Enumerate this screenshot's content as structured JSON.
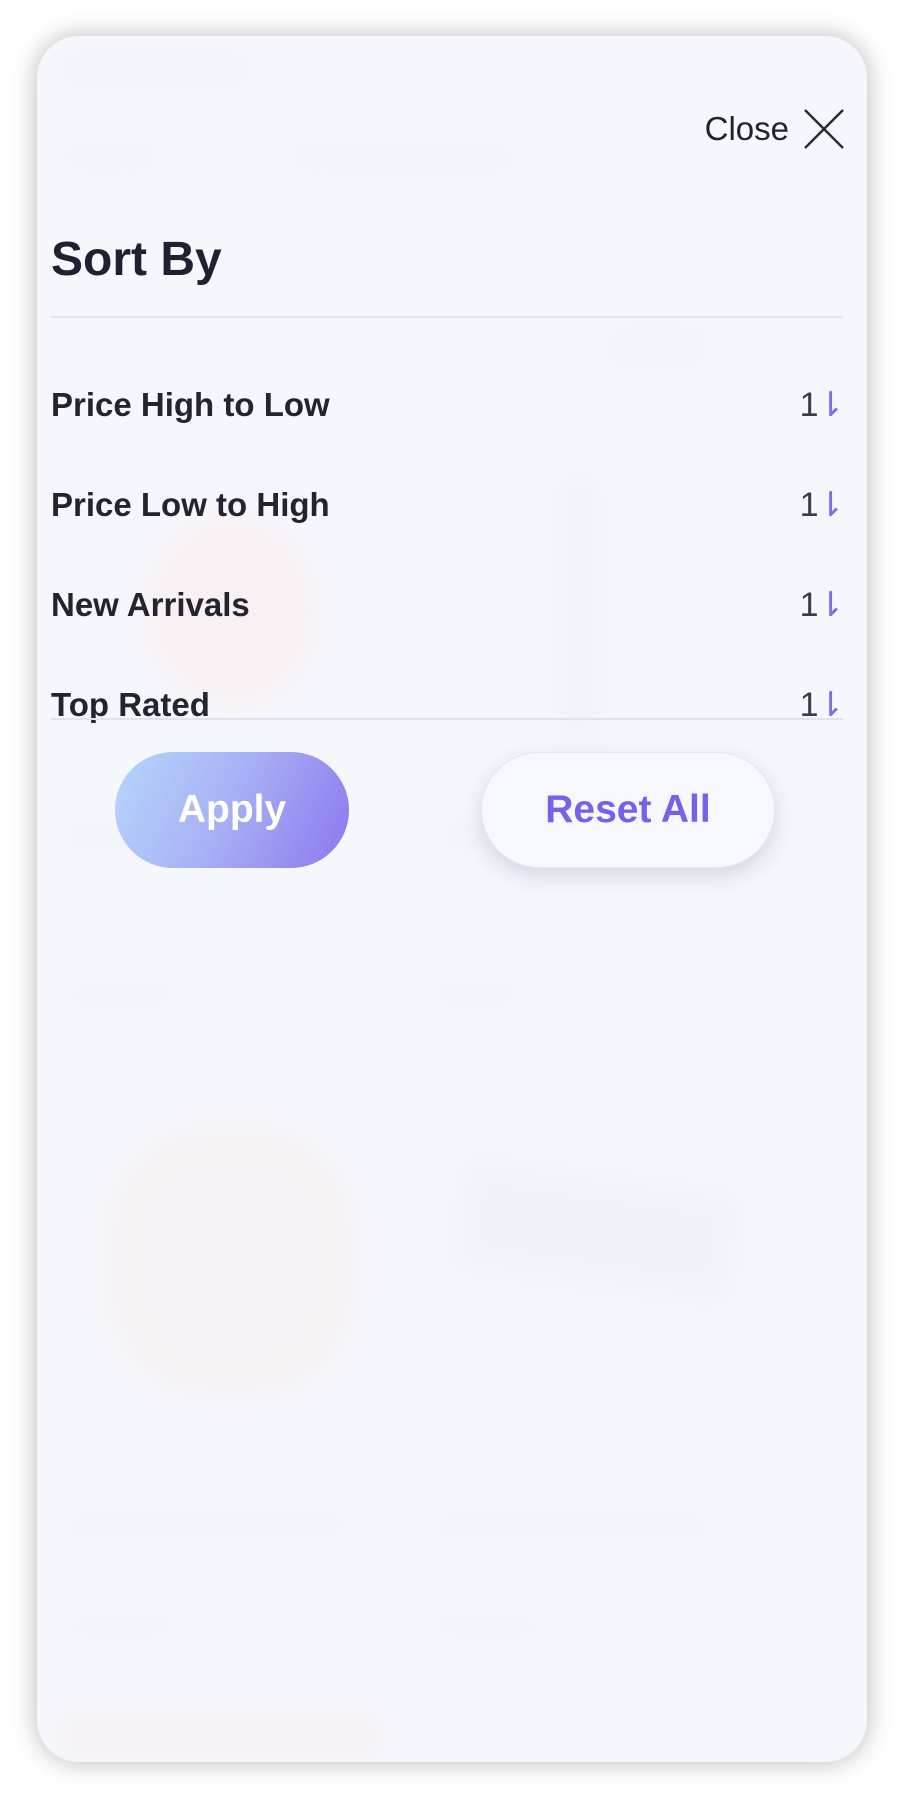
{
  "header": {
    "close_label": "Close"
  },
  "sheet": {
    "title": "Sort By",
    "options": [
      {
        "label": "Price High to Low",
        "icon": "sort-icon"
      },
      {
        "label": "Price Low to High",
        "icon": "sort-icon"
      },
      {
        "label": "New Arrivals",
        "icon": "sort-icon"
      },
      {
        "label": "Top Rated",
        "icon": "sort-icon"
      }
    ],
    "sort_glyph_number": "1",
    "sort_glyph_arrow": "⇂"
  },
  "actions": {
    "apply_label": "Apply",
    "reset_label": "Reset All"
  },
  "colors": {
    "accent": "#7a5fe8",
    "text": "#1f2031"
  }
}
